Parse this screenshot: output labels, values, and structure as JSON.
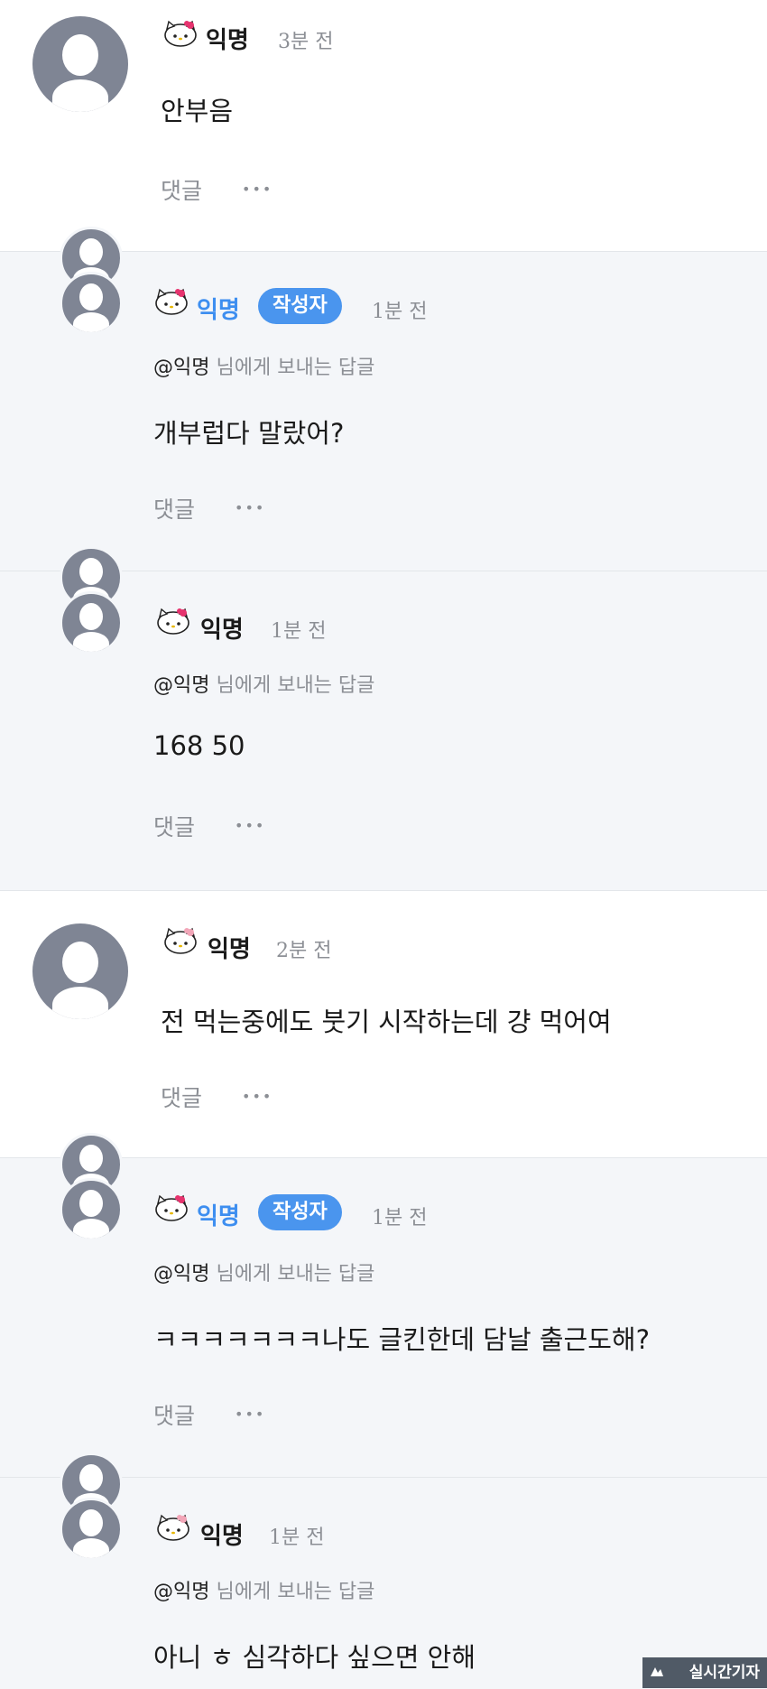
{
  "comments": [
    {
      "name": "익명",
      "time": "3분 전",
      "text": "안부음",
      "reply_label": "댓글",
      "more": "•••"
    },
    {
      "name": "익명",
      "badge": "작성자",
      "time": "1분 전",
      "mention_at": "@익명",
      "mention_rest": "님에게 보내는 답글",
      "text": "개부럽다 말랐어?",
      "reply_label": "댓글",
      "more": "•••"
    },
    {
      "name": "익명",
      "time": "1분 전",
      "mention_at": "@익명",
      "mention_rest": "님에게 보내는 답글",
      "text": "168 50",
      "reply_label": "댓글",
      "more": "•••"
    },
    {
      "name": "익명",
      "time": "2분 전",
      "text": "전 먹는중에도 붓기 시작하는데 걍 먹어여",
      "reply_label": "댓글",
      "more": "•••"
    },
    {
      "name": "익명",
      "badge": "작성자",
      "time": "1분 전",
      "mention_at": "@익명",
      "mention_rest": "님에게 보내는 답글",
      "text": "ㅋㅋㅋㅋㅋㅋㅋ나도 글킨한데 담날 출근도해?",
      "reply_label": "댓글",
      "more": "•••"
    },
    {
      "name": "익명",
      "time": "1분 전",
      "mention_at": "@익명",
      "mention_rest": "님에게 보내는 답글",
      "text": "아니 ㅎ 심각하다 싶으면 안해"
    }
  ],
  "watermark": "실시간기자",
  "colors": {
    "author_name": "#3d8ef0",
    "badge_bg": "#4a95ee",
    "reply_bg": "#f4f6f9",
    "avatar": "#7f8594",
    "meta": "#8c8f95"
  },
  "icons": [
    "hello-kitty-icon",
    "avatar-placeholder-icon",
    "more-dots-icon"
  ]
}
